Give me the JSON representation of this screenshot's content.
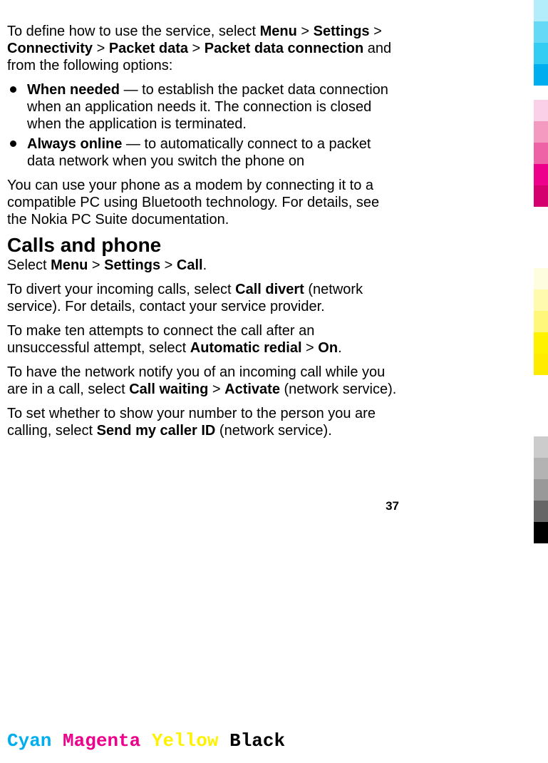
{
  "intro": {
    "seg1": "To define how to use the service, select ",
    "menu": "Menu",
    "gt": " > ",
    "settings": "Settings",
    "connectivity": "Connectivity",
    "packetdata": "Packet data",
    "packetdataconn": "Packet data connection",
    "seg_end": " and from the following options:"
  },
  "bullets": [
    {
      "title": "When needed",
      "body": " — to establish the packet data connection when an application needs it. The connection is closed when the application is terminated."
    },
    {
      "title": "Always online",
      "body": " —  to automatically connect to a packet data network when you switch the phone on"
    }
  ],
  "modem_para": "You can use your phone as a modem by connecting it to a compatible PC using Bluetooth technology. For details, see the Nokia PC Suite documentation.",
  "heading": "Calls and phone",
  "calls_nav": {
    "pre": "Select ",
    "menu": "Menu",
    "gt": " > ",
    "settings": "Settings",
    "call": "Call",
    "dot": "."
  },
  "divert": {
    "pre": "To divert your incoming calls, select ",
    "bold": "Call divert",
    "post": " (network service). For details, contact your service provider."
  },
  "redial": {
    "pre": "To make ten attempts to connect the call after an unsuccessful attempt, select ",
    "bold": "Automatic redial",
    "gt": " > ",
    "on": "On",
    "dot": "."
  },
  "waiting": {
    "pre": "To have the network notify you of an incoming call while you are in a call, select ",
    "bold": "Call waiting",
    "gt": " > ",
    "activate": "Activate",
    "post": " (network service)."
  },
  "callerid": {
    "pre": "To set whether to show your number to the person you are calling, select ",
    "bold": "Send my caller ID",
    "post": " (network service)."
  },
  "page_number": "37",
  "footer": {
    "cyan": "Cyan",
    "magenta": "Magenta",
    "yellow": "Yellow",
    "black": "Black"
  },
  "bars": {
    "cyan": [
      "#B3ECFB",
      "#66D9F7",
      "#33CCF3",
      "#00AEEF"
    ],
    "magenta": [
      "#FAD0E8",
      "#F49AC1",
      "#ED63A6",
      "#EC008C",
      "#D4006D"
    ],
    "yellow": [
      "#FFFDE0",
      "#FFFAAD",
      "#FFF77A",
      "#FFF200",
      "#FFEB00"
    ],
    "black": [
      "#CCCCCC",
      "#B3B3B3",
      "#999999",
      "#666666",
      "#000000"
    ]
  }
}
